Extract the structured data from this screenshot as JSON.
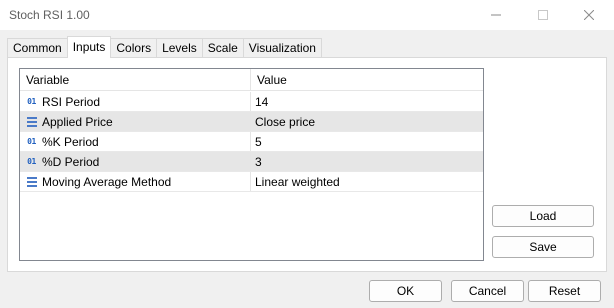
{
  "window": {
    "title": "Stoch RSI 1.00"
  },
  "tabs": [
    {
      "label": "Common"
    },
    {
      "label": "Inputs",
      "active": true
    },
    {
      "label": "Colors"
    },
    {
      "label": "Levels"
    },
    {
      "label": "Scale"
    },
    {
      "label": "Visualization"
    }
  ],
  "table": {
    "headers": {
      "variable": "Variable",
      "value": "Value"
    },
    "rows": [
      {
        "icon": "integer-icon",
        "icon_text": "01",
        "variable": "RSI Period",
        "value": "14"
      },
      {
        "icon": "enum-list-icon",
        "variable": "Applied Price",
        "value": "Close price"
      },
      {
        "icon": "integer-icon",
        "icon_text": "01",
        "variable": "%K Period",
        "value": "5"
      },
      {
        "icon": "integer-icon",
        "icon_text": "01",
        "variable": "%D Period",
        "value": "3"
      },
      {
        "icon": "enum-list-icon",
        "variable": "Moving Average Method",
        "value": "Linear weighted"
      }
    ]
  },
  "side_buttons": {
    "load": "Load",
    "save": "Save"
  },
  "footer_buttons": {
    "ok": "OK",
    "cancel": "Cancel",
    "reset": "Reset"
  },
  "colors": {
    "icon_blue": "#1f5fbf",
    "row_alt": "#e6e6e6"
  }
}
